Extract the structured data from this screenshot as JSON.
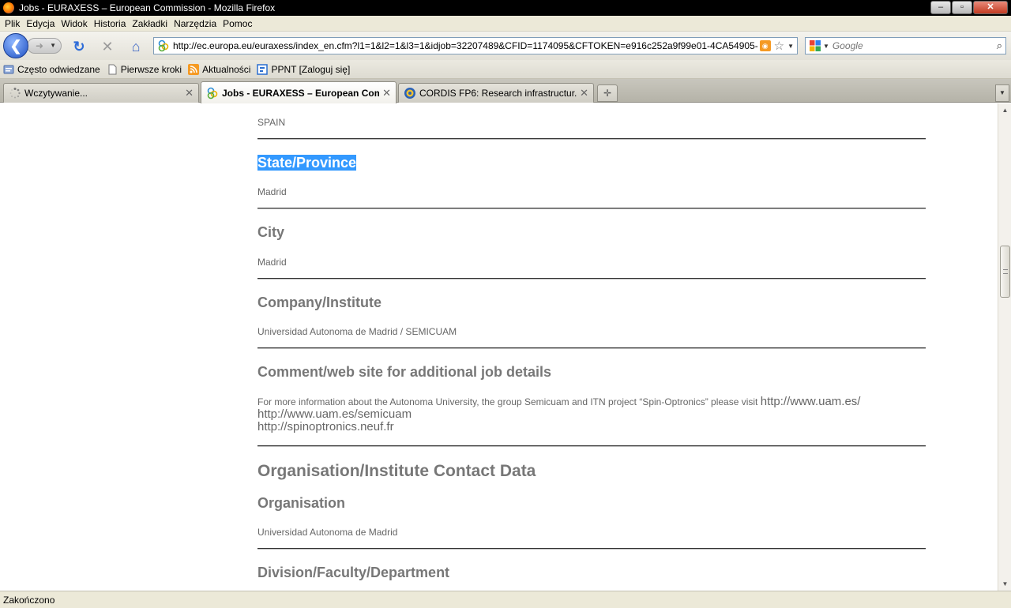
{
  "window": {
    "title": "Jobs - EURAXESS – European Commission - Mozilla Firefox",
    "buttons": [
      "minimize",
      "maximize",
      "close"
    ]
  },
  "menubar": {
    "items": [
      "Plik",
      "Edycja",
      "Widok",
      "Historia",
      "Zakładki",
      "Narzędzia",
      "Pomoc"
    ]
  },
  "navbar": {
    "back_icon": "back-arrow-icon",
    "forward_icon": "forward-arrow-icon",
    "reload_icon": "reload-icon",
    "stop_icon": "stop-icon",
    "home_icon": "home-icon",
    "url": "http://ec.europa.eu/euraxess/index_en.cfm?l1=1&l2=1&l3=1&idjob=32207489&CFID=1174095&CFTOKEN=e916c252a9f99e01-4CA54905-",
    "search_placeholder": "Google"
  },
  "bookmarks": {
    "items": [
      {
        "label": "Często odwiedzane",
        "icon": "frequent-icon"
      },
      {
        "label": "Pierwsze kroki",
        "icon": "page-icon"
      },
      {
        "label": "Aktualności",
        "icon": "rss-icon"
      },
      {
        "label": "PPNT [Zaloguj się]",
        "icon": "bookmark-icon"
      }
    ]
  },
  "tabs": [
    {
      "label": "Wczytywanie...",
      "active": false
    },
    {
      "label": "Jobs - EURAXESS – European Com...",
      "active": true
    },
    {
      "label": "CORDIS FP6: Research infrastructur...",
      "active": false
    }
  ],
  "content": {
    "country_value": "SPAIN",
    "state_label": "State/Province",
    "state_value": "Madrid",
    "city_label": "City",
    "city_value": "Madrid",
    "company_label": "Company/Institute",
    "company_value": "Universidad Autonoma de Madrid / SEMICUAM",
    "comment_label": "Comment/web site for additional job details",
    "comment_text": "For more information about the Autonoma University, the group Semicuam and ITN project “Spin-Optronics” please visit",
    "comment_urls": [
      "http://www.uam.es/",
      "http://www.uam.es/semicuam",
      "http://spinoptronics.neuf.fr"
    ],
    "contact_section_title": "Organisation/Institute Contact Data",
    "organisation_label": "Organisation",
    "organisation_value": "Universidad Autonoma de Madrid",
    "division_label": "Division/Faculty/Department"
  },
  "statusbar": {
    "text": "Zakończono"
  },
  "colors": {
    "selection": "#3399ff",
    "label_gray": "#777777",
    "value_gray": "#666666"
  }
}
